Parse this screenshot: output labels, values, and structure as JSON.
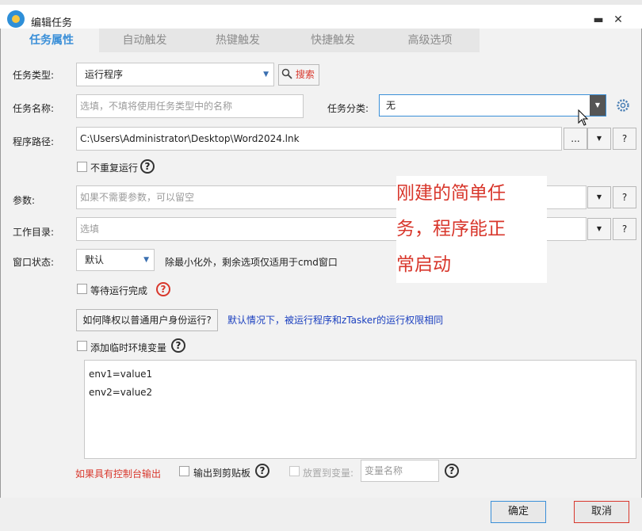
{
  "window": {
    "title": "编辑任务",
    "minimize": "▬",
    "maximize": "☐",
    "close": "✕"
  },
  "tabs": [
    {
      "label": "任务属性",
      "active": true
    },
    {
      "label": "自动触发"
    },
    {
      "label": "热键触发"
    },
    {
      "label": "快捷触发"
    },
    {
      "label": "高级选项"
    }
  ],
  "form": {
    "task_type": {
      "label": "任务类型:",
      "value": "运行程序",
      "search_label": "搜索"
    },
    "task_name": {
      "label": "任务名称:",
      "placeholder": "选填，不填将使用任务类型中的名称"
    },
    "task_category": {
      "label": "任务分类:",
      "value": "无"
    },
    "program_path": {
      "label": "程序路径:",
      "value": "C:\\Users\\Administrator\\Desktop\\Word2024.lnk",
      "browse": "...",
      "help": "?"
    },
    "no_repeat": {
      "label": "不重复运行"
    },
    "params": {
      "label": "参数:",
      "placeholder": "如果不需要参数，可以留空"
    },
    "workdir": {
      "label": "工作目录:",
      "placeholder": "选填"
    },
    "window_state": {
      "label": "窗口状态:",
      "value": "默认",
      "hint": "除最小化外，剩余选项仅适用于cmd窗口"
    },
    "wait_finish": {
      "label": "等待运行完成"
    },
    "downgrade": {
      "button": "如何降权以普通用户身份运行?",
      "note": "默认情况下，被运行程序和zTasker的运行权限相同"
    },
    "add_env": {
      "label": "添加临时环境变量"
    },
    "env_lines": [
      "env1=value1",
      "env2=value2"
    ],
    "console": {
      "label": "如果具有控制台输出",
      "clipboard": "输出到剪贴板",
      "to_var": "放置到变量:",
      "var_placeholder": "变量名称"
    }
  },
  "annotation": {
    "lines": [
      "刚建的简单任",
      "务，程序能正",
      "常启动"
    ]
  },
  "buttons": {
    "ok": "确定",
    "cancel": "取消"
  },
  "colors": {
    "accent": "#3a8fd8",
    "warn": "#d8372c",
    "link": "#1a3fbf"
  }
}
